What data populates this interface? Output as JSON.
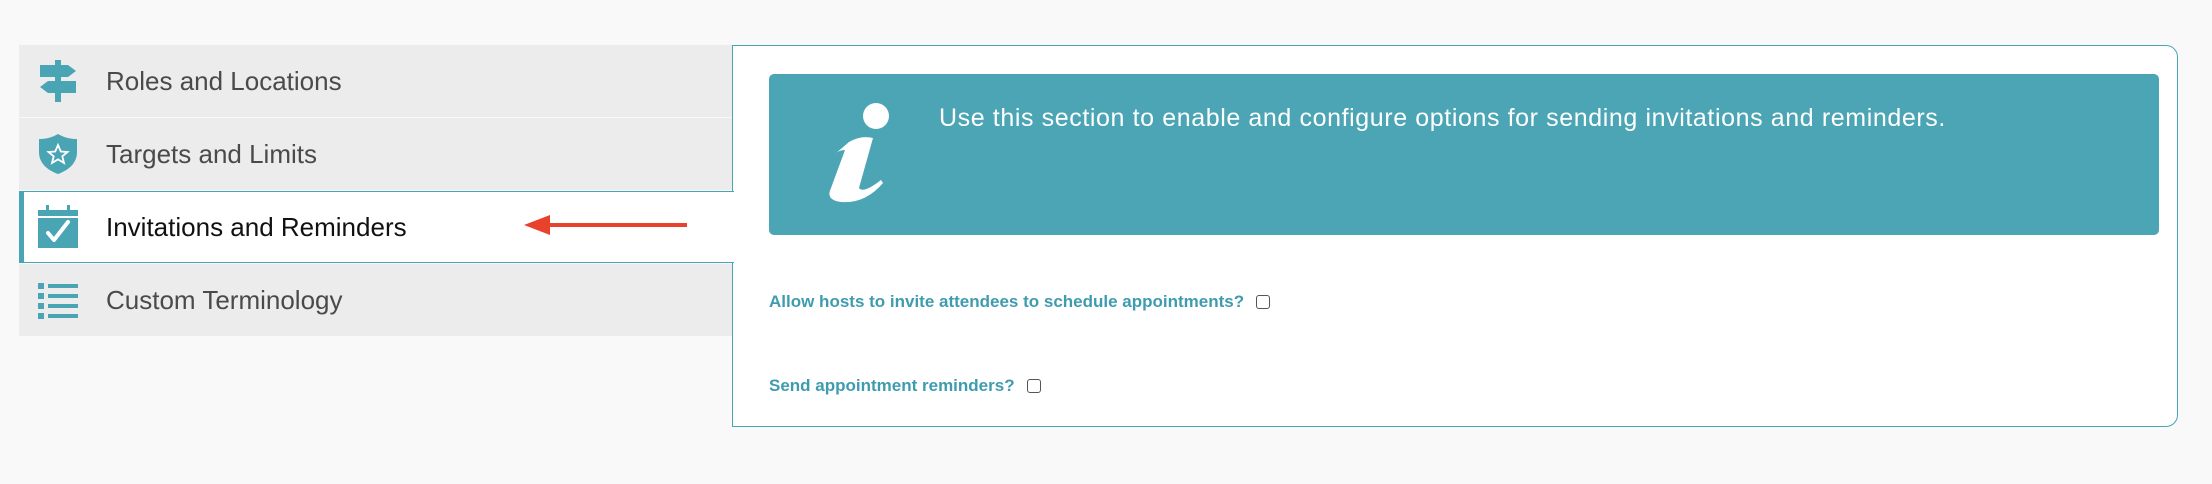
{
  "sidebar": {
    "items": [
      {
        "label": "Roles and Locations",
        "icon": "signpost-icon"
      },
      {
        "label": "Targets and Limits",
        "icon": "shield-star-icon"
      },
      {
        "label": "Invitations and Reminders",
        "icon": "calendar-check-icon",
        "active": true
      },
      {
        "label": "Custom Terminology",
        "icon": "list-icon"
      }
    ]
  },
  "panel": {
    "info_text": "Use this section to enable and configure options for sending invitations and reminders.",
    "info_icon": "info-icon",
    "options": [
      {
        "label": "Allow hosts to invite attendees to schedule appointments?",
        "checked": false
      },
      {
        "label": "Send appointment reminders?",
        "checked": false
      }
    ]
  },
  "colors": {
    "accent": "#49a5b4",
    "arrow": "#e8412c",
    "sidebar_bg": "#ececec"
  }
}
